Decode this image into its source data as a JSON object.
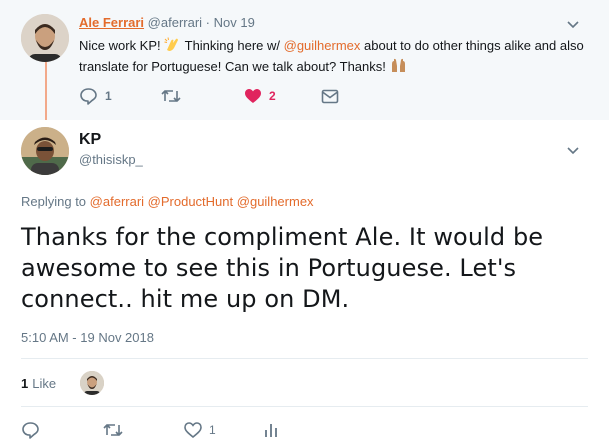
{
  "parent_tweet": {
    "name": "Ale Ferrari",
    "handle": "@aferrari",
    "date": "· Nov 19",
    "text_parts": {
      "t1": "Nice work KP! ",
      "t2": " Thinking here w/ ",
      "mention": "@guilhermex",
      "t3": " about to do other things alike and also translate for Portuguese! Can we talk about? Thanks! "
    },
    "emoji": [
      "clapping-hands",
      "raised-hands"
    ],
    "reply_count": "1",
    "retweet_count": "",
    "like_count": "2"
  },
  "main_tweet": {
    "name": "KP",
    "handle": "@thisiskp_",
    "replying_label": "Replying to",
    "replying_to": [
      "@aferrari",
      "@ProductHunt",
      "@guilhermex"
    ],
    "text": "Thanks for the compliment Ale. It would be awesome to see this in Portuguese. Let's connect.. hit me up on DM.",
    "timestamp": "5:10 AM - 19 Nov 2018",
    "likes": {
      "count": "1",
      "label": "Like"
    },
    "actions": {
      "reply_count": "",
      "retweet_count": "",
      "like_count": "1"
    }
  },
  "colors": {
    "accent": "#e36b2c",
    "muted": "#657786",
    "like": "#e0245e",
    "parent_bg": "#f5f8fa"
  }
}
